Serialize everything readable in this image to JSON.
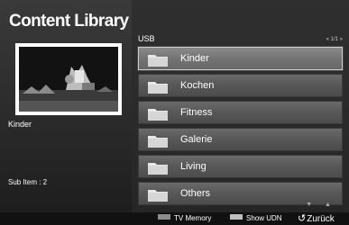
{
  "app": {
    "title": "Content Library"
  },
  "left": {
    "selected_name": "Kinder",
    "sub_item": "Sub Item : 2"
  },
  "right": {
    "source": "USB",
    "page_indicator": "« 1/1 »",
    "items": [
      {
        "label": "Kinder",
        "selected": true
      },
      {
        "label": "Kochen",
        "selected": false
      },
      {
        "label": "Fitness",
        "selected": false
      },
      {
        "label": "Galerie",
        "selected": false
      },
      {
        "label": "Living",
        "selected": false
      },
      {
        "label": "Others",
        "selected": false
      }
    ],
    "scroll_arrows": "▼ ▲"
  },
  "bottom": {
    "hint_a": {
      "label": "TV Memory",
      "color": "#8c8c8c"
    },
    "hint_b": {
      "label": "Show UDN",
      "color": "#bfbfbf"
    },
    "back": {
      "glyph": "↺",
      "label": "Zurück"
    }
  },
  "colors": {
    "folder": "#e8e8e8"
  }
}
